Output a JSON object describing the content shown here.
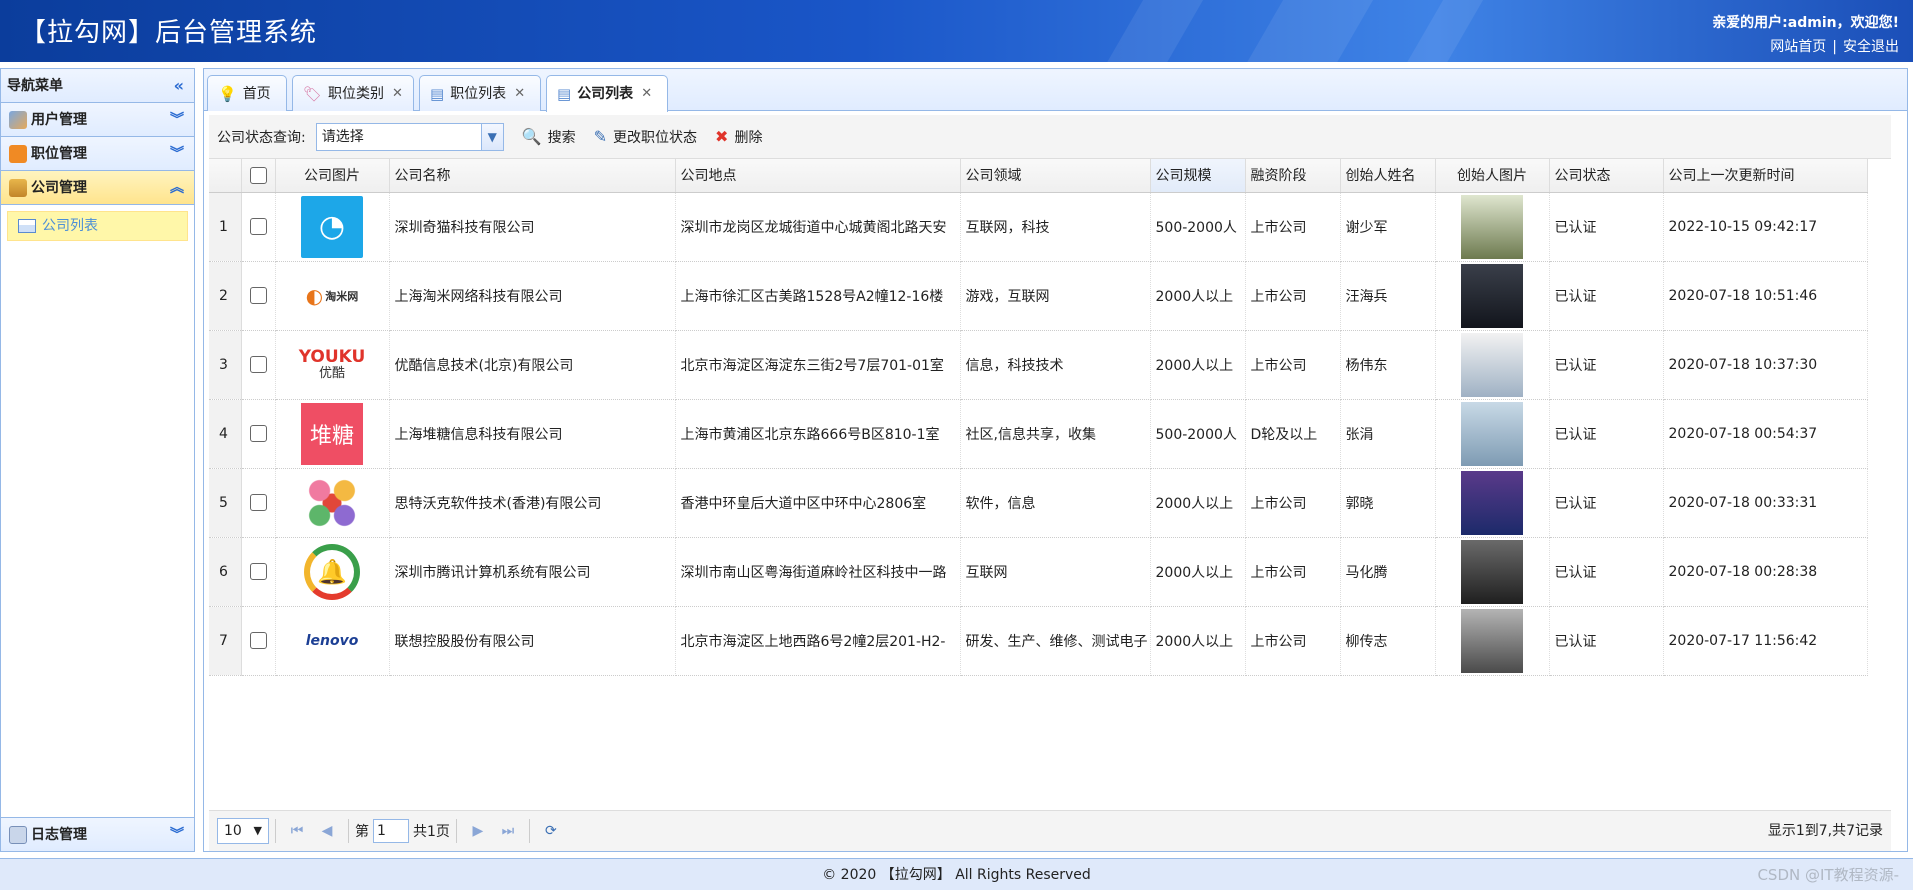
{
  "header": {
    "title": "【拉勾网】后台管理系统",
    "welcome": "亲爱的用户:admin，欢迎您!",
    "home_link": "网站首页",
    "sep": "|",
    "logout_link": "安全退出"
  },
  "nav": {
    "title": "导航菜单",
    "groups": [
      {
        "label": "用户管理",
        "icon": "users-icon"
      },
      {
        "label": "职位管理",
        "icon": "rss-icon"
      },
      {
        "label": "公司管理",
        "icon": "home-icon"
      }
    ],
    "sub_item": "公司列表",
    "log_group": "日志管理"
  },
  "tabs": [
    {
      "label": "首页",
      "icon": "lightbulb-icon"
    },
    {
      "label": "职位类别",
      "icon": "tag-icon"
    },
    {
      "label": "职位列表",
      "icon": "list-icon"
    },
    {
      "label": "公司列表",
      "icon": "list-icon"
    }
  ],
  "toolbar": {
    "status_label": "公司状态查询:",
    "status_placeholder": "请选择",
    "search": "搜索",
    "change_status": "更改职位状态",
    "delete": "删除"
  },
  "table": {
    "columns": [
      "公司图片",
      "公司名称",
      "公司地点",
      "公司领域",
      "公司规模",
      "融资阶段",
      "创始人姓名",
      "创始人图片",
      "公司状态",
      "公司上一次更新时间"
    ],
    "rows": [
      {
        "n": "1",
        "name": "深圳奇猫科技有限公司",
        "loc": "深圳市龙岗区龙城街道中心城黄阁北路天安",
        "field": "互联网，科技",
        "size": "500-2000人",
        "stage": "上市公司",
        "founder": "谢少军",
        "status": "已认证",
        "time": "2022-10-15 09:42:17",
        "logo": "cat-clock-logo"
      },
      {
        "n": "2",
        "name": "上海淘米网络科技有限公司",
        "loc": "上海市徐汇区古美路1528号A2幢12-16楼",
        "field": "游戏，互联网",
        "size": "2000人以上",
        "stage": "上市公司",
        "founder": "汪海兵",
        "status": "已认证",
        "time": "2020-07-18 10:51:46",
        "logo": "taomee-logo",
        "logo_text": "淘米网"
      },
      {
        "n": "3",
        "name": "优酷信息技术(北京)有限公司",
        "loc": "北京市海淀区海淀东三街2号7层701-01室",
        "field": "信息，科技技术",
        "size": "2000人以上",
        "stage": "上市公司",
        "founder": "杨伟东",
        "status": "已认证",
        "time": "2020-07-18 10:37:30",
        "logo": "youku-logo",
        "logo_text": "YOUKU",
        "logo_text2": "优酷"
      },
      {
        "n": "4",
        "name": "上海堆糖信息科技有限公司",
        "loc": "上海市黄浦区北京东路666号B区810-1室",
        "field": "社区,信息共享，收集",
        "size": "500-2000人",
        "stage": "D轮及以上",
        "founder": "张涓",
        "status": "已认证",
        "time": "2020-07-18 00:54:37",
        "logo": "duitang-logo",
        "logo_text": "堆糖"
      },
      {
        "n": "5",
        "name": "思特沃克软件技术(香港)有限公司",
        "loc": "香港中环皇后大道中区中环中心2806室",
        "field": "软件，信息",
        "size": "2000人以上",
        "stage": "上市公司",
        "founder": "郭晓",
        "status": "已认证",
        "time": "2020-07-18 00:33:31",
        "logo": "thoughtworks-logo"
      },
      {
        "n": "6",
        "name": "深圳市腾讯计算机系统有限公司",
        "loc": "深圳市南山区粤海街道麻岭社区科技中一路",
        "field": "互联网",
        "size": "2000人以上",
        "stage": "上市公司",
        "founder": "马化腾",
        "status": "已认证",
        "time": "2020-07-18 00:28:38",
        "logo": "tencent-logo"
      },
      {
        "n": "7",
        "name": "联想控股股份有限公司",
        "loc": "北京市海淀区上地西路6号2幢2层201-H2-",
        "field": "研发、生产、维修、测试电子",
        "size": "2000人以上",
        "stage": "上市公司",
        "founder": "柳传志",
        "status": "已认证",
        "time": "2020-07-17 11:56:42",
        "logo": "lenovo-logo",
        "logo_text": "lenovo"
      }
    ]
  },
  "pager": {
    "page_size": "10",
    "page_prefix": "第",
    "page_value": "1",
    "page_total": "共1页",
    "info": "显示1到7,共7记录"
  },
  "footer": {
    "copyright": "© 2020 【拉勾网】 All Rights Reserved",
    "watermark": "CSDN @IT教程资源-"
  },
  "colors": {
    "accent": "#95b8e7",
    "header": "#1a56c8",
    "active_group": "#ffe48d"
  }
}
